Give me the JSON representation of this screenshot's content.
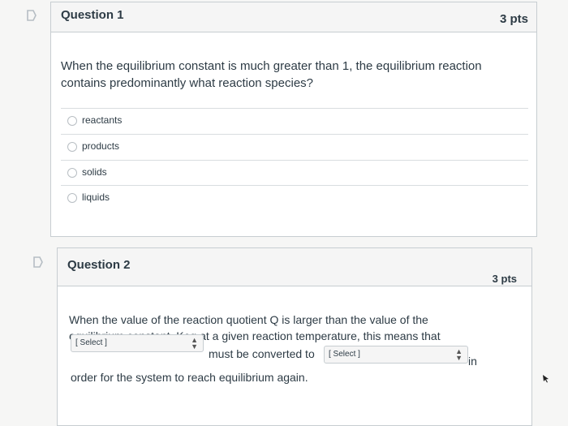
{
  "question1": {
    "title": "Question 1",
    "points": "3 pts",
    "text": "When the equilibrium constant is much greater than 1, the equilibrium reaction contains predominantly what reaction species?",
    "answers": [
      "reactants",
      "products",
      "solids",
      "liquids"
    ]
  },
  "question2": {
    "title": "Question 2",
    "points": "3 pts",
    "text": "When the value of the reaction quotient Q is larger than the value of the equilibrium constant, Keq at a given reaction temperature, this means that",
    "select1": "[ Select ]",
    "middle_text": "must be converted to",
    "select2": "[ Select ]",
    "after_text": "in",
    "end_text": "order for the system to reach equilibrium again."
  }
}
